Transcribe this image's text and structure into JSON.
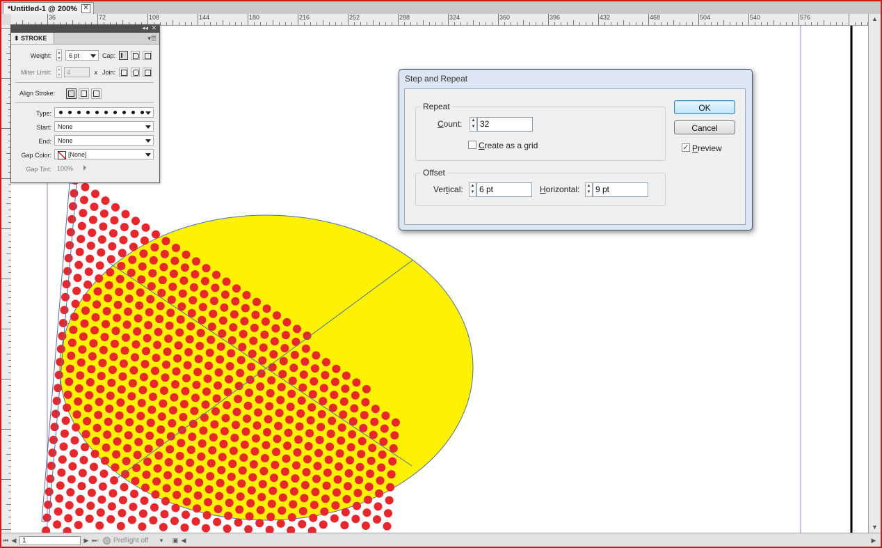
{
  "document": {
    "tab_title": "*Untitled-1 @ 200%",
    "close_glyph": "✕"
  },
  "ruler": {
    "top_labels": [
      "36",
      "72",
      "108",
      "144",
      "180",
      "216",
      "252",
      "288",
      "324",
      "360",
      "396",
      "432",
      "468",
      "504",
      "540",
      "576"
    ]
  },
  "stroke_panel": {
    "title": "STROKE",
    "weight_label": "Weight:",
    "weight_value": "6 pt",
    "cap_label": "Cap:",
    "miter_label": "Miter Limit:",
    "miter_value": "4",
    "miter_x": "x",
    "join_label": "Join:",
    "align_label": "Align Stroke:",
    "type_label": "Type:",
    "start_label": "Start:",
    "start_value": "None",
    "end_label": "End:",
    "end_value": "None",
    "gap_color_label": "Gap Color:",
    "gap_color_value": "[None]",
    "gap_tint_label": "Gap Tint:",
    "gap_tint_value": "100%"
  },
  "dialog": {
    "title": "Step and Repeat",
    "repeat_group": "Repeat",
    "count_label_u": "C",
    "count_label_rest": "ount:",
    "count_value": "32",
    "grid_label_u": "C",
    "grid_label_rest": "reate as a grid",
    "grid_checked": false,
    "offset_group": "Offset",
    "vertical_label_pre": "Ver",
    "vertical_label_u": "t",
    "vertical_label_post": "ical:",
    "vertical_value": "6 pt",
    "horizontal_label_u": "H",
    "horizontal_label_rest": "orizontal:",
    "horizontal_value": "9 pt",
    "ok_label": "OK",
    "cancel_label": "Cancel",
    "preview_label_u": "P",
    "preview_label_rest": "review",
    "preview_checked": true
  },
  "status_bar": {
    "page_value": "1",
    "preflight": "Preflight off"
  },
  "colors": {
    "ellipse_fill": "#fff200",
    "dot_fill": "#e8262b",
    "guide": "#a07ac0",
    "outline": "#4a6fb0"
  }
}
